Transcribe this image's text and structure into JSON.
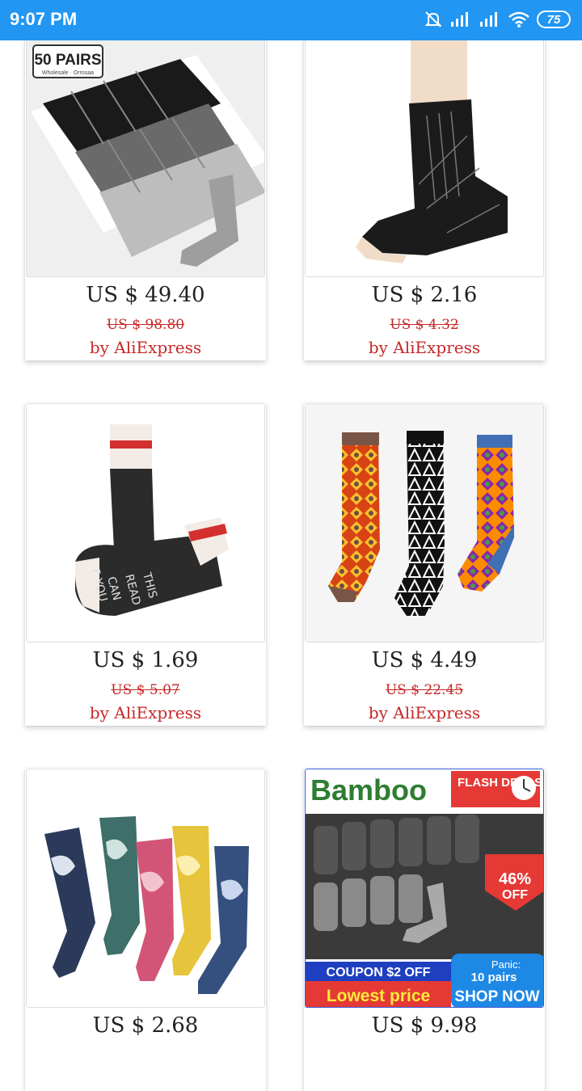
{
  "status_bar": {
    "time": "9:07 PM",
    "battery": "75"
  },
  "products": [
    {
      "price": "US $ 49.40",
      "old_price": "US $ 98.80",
      "seller": "by AliExpress",
      "badge": "50 PAIRS",
      "badge_sub": "Wholesale · Orrosaa"
    },
    {
      "price": "US $ 2.16",
      "old_price": "US $ 4.32",
      "seller": "by AliExpress"
    },
    {
      "price": "US $ 1.69",
      "old_price": "US $ 5.07",
      "seller": "by AliExpress",
      "sock_text": [
        "F YOU",
        "CAN",
        "READ",
        "THIS"
      ]
    },
    {
      "price": "US $ 4.49",
      "old_price": "US $ 22.45",
      "seller": "by AliExpress"
    },
    {
      "price": "US $ 2.68",
      "old_price": "",
      "seller": ""
    },
    {
      "price": "US $ 9.98",
      "old_price": "",
      "seller": "",
      "ad": {
        "brand": "Bamboo",
        "flash": "FLASH DEALS",
        "discount": "46%",
        "off": "OFF",
        "coupon": "COUPON $2 OFF",
        "lowest": "Lowest price",
        "panic": "Panic:",
        "pairs": "10 pairs",
        "shop": "SHOP NOW"
      }
    }
  ]
}
